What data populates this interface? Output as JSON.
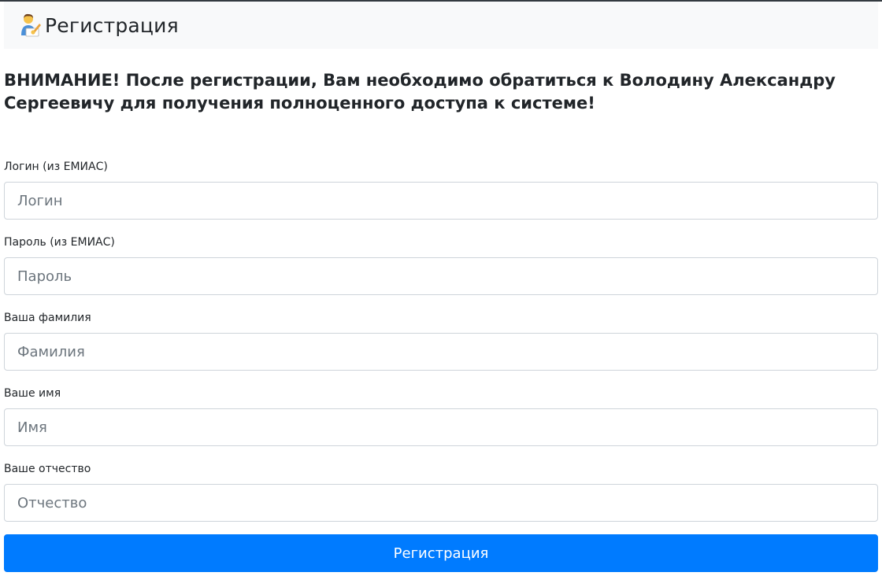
{
  "header": {
    "icon": "writing-hand-icon",
    "title": "Регистрация"
  },
  "notice": "ВНИМАНИЕ! После регистрации, Вам необходимо обратиться к Володину Александру Сергеевичу для получения полноценного доступа к системе!",
  "form": {
    "fields": [
      {
        "label": "Логин (из ЕМИАС)",
        "placeholder": "Логин",
        "value": ""
      },
      {
        "label": "Пароль (из ЕМИАС)",
        "placeholder": "Пароль",
        "value": ""
      },
      {
        "label": "Ваша фамилия",
        "placeholder": "Фамилия",
        "value": ""
      },
      {
        "label": "Ваше имя",
        "placeholder": "Имя",
        "value": ""
      },
      {
        "label": "Ваше отчество",
        "placeholder": "Отчество",
        "value": ""
      }
    ],
    "submit_label": "Регистрация"
  },
  "colors": {
    "header_bg": "#f8f9fa",
    "button_bg": "#007bff",
    "text": "#212529",
    "input_border": "#ced4da"
  }
}
